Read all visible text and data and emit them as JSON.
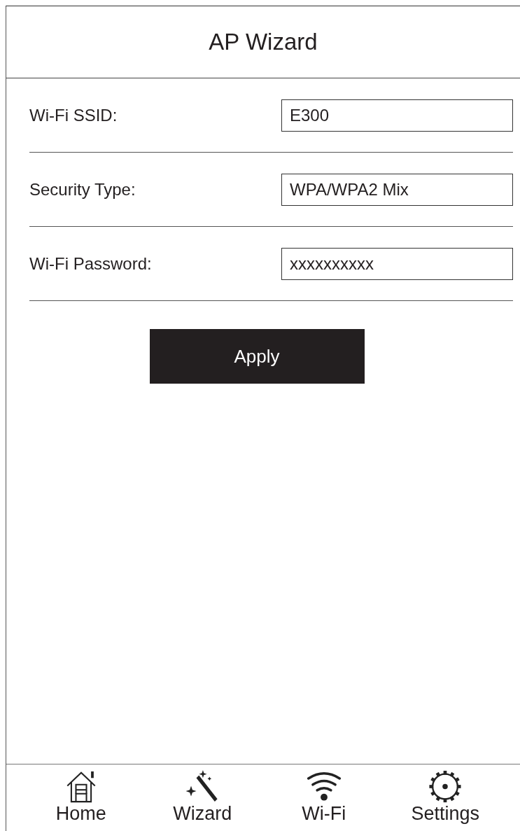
{
  "header": {
    "title": "AP Wizard"
  },
  "fields": [
    {
      "label": "Wi-Fi SSID:",
      "value": "E300"
    },
    {
      "label": "Security Type:",
      "value": "WPA/WPA2 Mix"
    },
    {
      "label": "Wi-Fi Password:",
      "value": "xxxxxxxxxx"
    }
  ],
  "apply_button": "Apply",
  "nav": [
    {
      "kind": "home",
      "label": "Home"
    },
    {
      "kind": "wizard",
      "label": "Wizard"
    },
    {
      "kind": "wifi",
      "label": "Wi-Fi"
    },
    {
      "kind": "settings",
      "label": "Settings"
    }
  ]
}
